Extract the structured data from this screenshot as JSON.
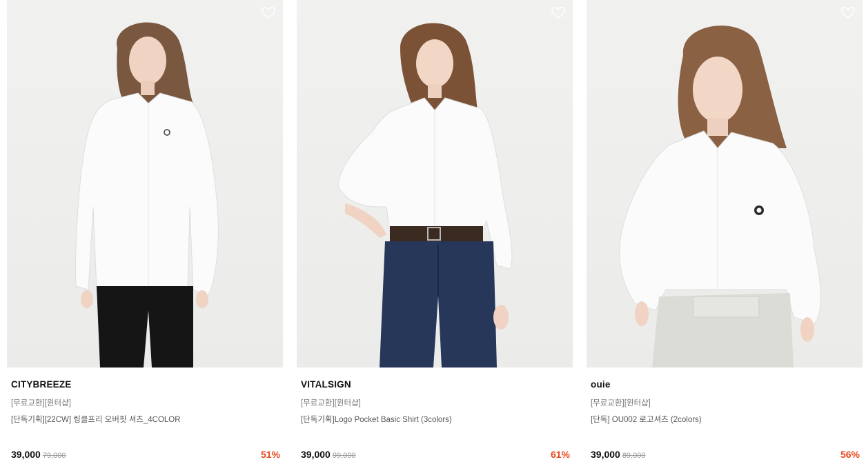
{
  "colors": {
    "discount": "#e8471f",
    "price": "#111111",
    "original_price": "#999999"
  },
  "products": [
    {
      "brand": "CITYBREEZE",
      "tag": "[무료교환][윈터샵]",
      "name": "[단독기획][22CW] 링클프리 오버핏 셔츠_4COLOR",
      "price": "39,000",
      "original_price": "79,000",
      "discount": "51%",
      "wish_icon": "heart-outline-icon"
    },
    {
      "brand": "VITALSIGN",
      "tag": "[무료교환][윈터샵]",
      "name": "[단독기획]Logo Pocket Basic Shirt (3colors)",
      "price": "39,000",
      "original_price": "99,000",
      "discount": "61%",
      "wish_icon": "heart-outline-icon"
    },
    {
      "brand": "ouie",
      "tag": "[무료교환][윈터샵]",
      "name": "[단독] OU002 로고셔츠 (2colors)",
      "price": "39,000",
      "original_price": "89,000",
      "discount": "56%",
      "wish_icon": "heart-outline-icon"
    }
  ]
}
